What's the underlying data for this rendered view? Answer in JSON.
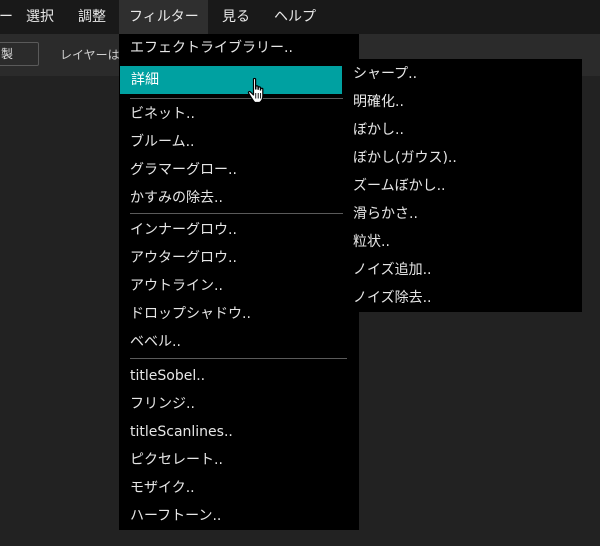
{
  "menubar": {
    "items": [
      {
        "label": "ー"
      },
      {
        "label": "選択"
      },
      {
        "label": "調整"
      },
      {
        "label": "フィルター"
      },
      {
        "label": "見る"
      },
      {
        "label": "ヘルプ"
      }
    ]
  },
  "toolbar": {
    "button_label": "製",
    "hint_text": "レイヤーは"
  },
  "filter_menu": {
    "items": [
      {
        "label": "エフェクトライブラリー.."
      },
      {
        "label": "詳細"
      },
      {
        "label": "ビネット.."
      },
      {
        "label": "ブルーム.."
      },
      {
        "label": "グラマーグロー.."
      },
      {
        "label": "かすみの除去.."
      },
      {
        "label": "インナーグロウ.."
      },
      {
        "label": "アウターグロウ.."
      },
      {
        "label": "アウトライン.."
      },
      {
        "label": "ドロップシャドウ.."
      },
      {
        "label": "ベベル.."
      },
      {
        "label": "titleSobel.."
      },
      {
        "label": "フリンジ.."
      },
      {
        "label": "titleScanlines.."
      },
      {
        "label": "ピクセレート.."
      },
      {
        "label": "モザイク.."
      },
      {
        "label": "ハーフトーン.."
      }
    ]
  },
  "details_submenu": {
    "items": [
      {
        "label": "シャープ.."
      },
      {
        "label": "明確化.."
      },
      {
        "label": "ぼかし.."
      },
      {
        "label": "ぼかし(ガウス).."
      },
      {
        "label": "ズームぼかし.."
      },
      {
        "label": "滑らかさ.."
      },
      {
        "label": "粒状.."
      },
      {
        "label": "ノイズ追加.."
      },
      {
        "label": "ノイズ除去.."
      }
    ]
  },
  "colors": {
    "highlight": "#00a1a1",
    "menu_bg": "#000000",
    "menubar_bg": "#191919",
    "toolbar_bg": "#2b2b2b",
    "canvas_bg": "#222222"
  },
  "icons": {
    "cursor": "hand-pointer-icon"
  }
}
